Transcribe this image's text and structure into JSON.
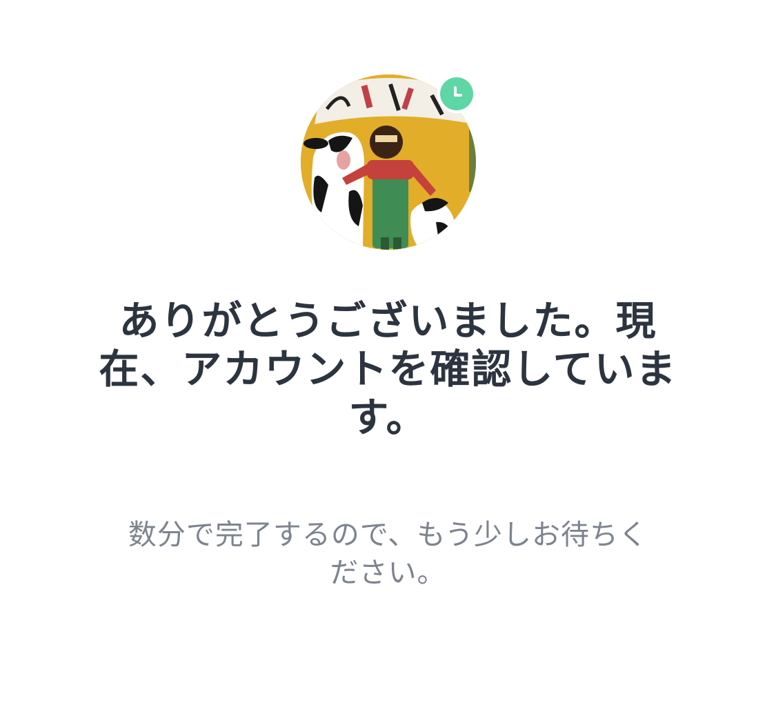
{
  "profile": {
    "avatar_label": "profile picture",
    "status_icon": "clock-icon"
  },
  "message": {
    "title": "ありがとうございました。現在、アカウントを確認しています。",
    "subtitle": "数分で完了するので、もう少しお待ちください。"
  },
  "colors": {
    "title_text": "#2c3440",
    "subtitle_text": "#7d848e",
    "badge_green": "#5ed6a6",
    "background": "#ffffff"
  }
}
